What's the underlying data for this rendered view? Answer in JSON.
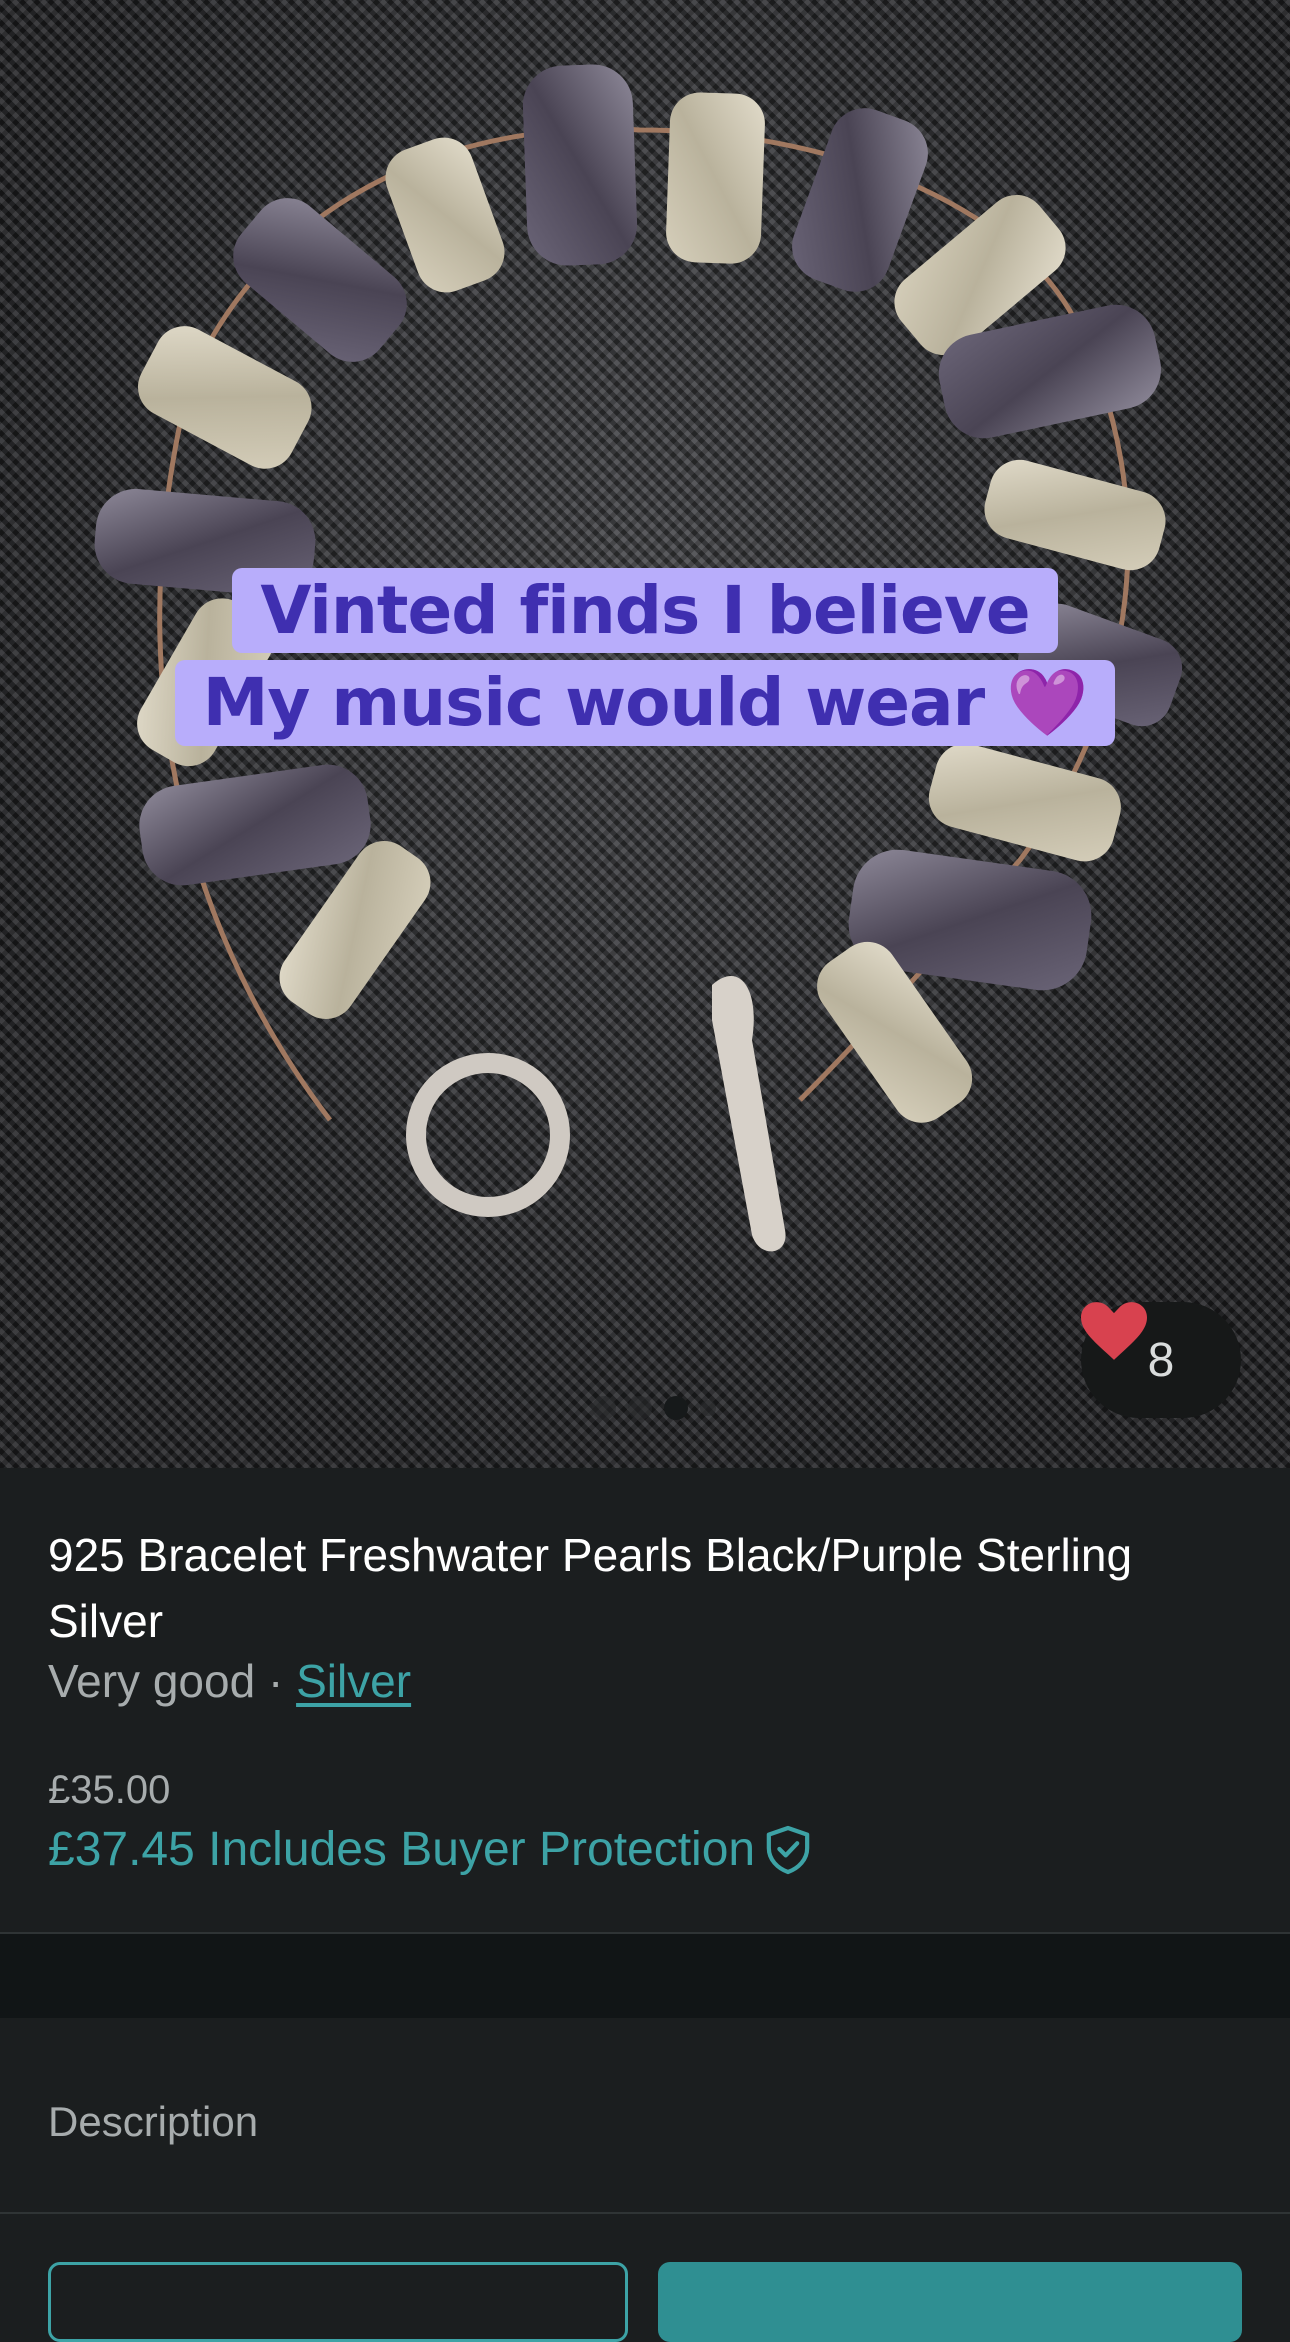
{
  "photo": {
    "caption_line1": "Vinted finds I believe",
    "caption_line2": "My music would wear",
    "caption_emoji": "💜",
    "favourite_count": "8",
    "pagination": {
      "total": 4,
      "active": 3
    }
  },
  "item": {
    "title": "925 Bracelet Freshwater Pearls Black/Purple Sterling Silver",
    "condition": "Very good",
    "separator": " · ",
    "brand": "Silver",
    "price": "£35.00",
    "price_with_protection": "£37.45 Includes Buyer Protection"
  },
  "description": {
    "label": "Description"
  },
  "colors": {
    "accent": "#3da3a6",
    "background": "#1b1e1f",
    "heart": "#d8424f",
    "caption_bg": "#b8adfb",
    "caption_text": "#3f2fb0"
  },
  "icons": [
    "heart-icon",
    "shield-check-icon"
  ]
}
